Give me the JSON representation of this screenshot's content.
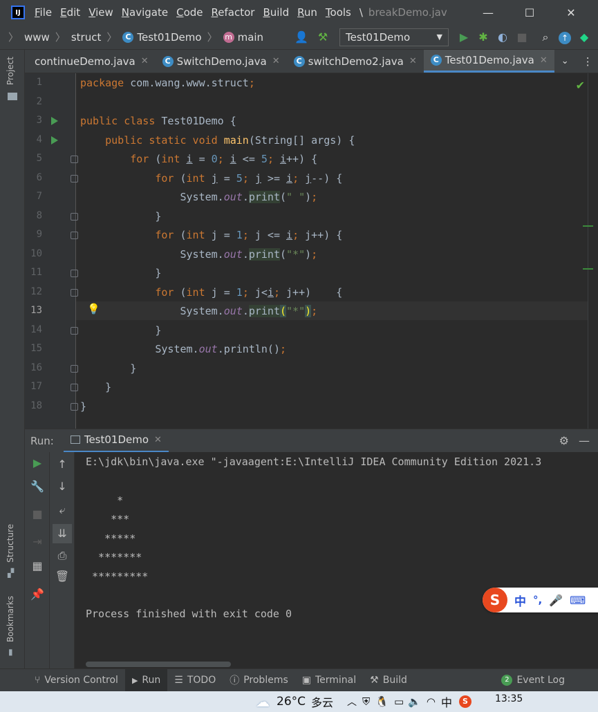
{
  "menu": {
    "logo": "IJ",
    "items": [
      {
        "first": "F",
        "rest": "ile"
      },
      {
        "first": "E",
        "rest": "dit"
      },
      {
        "first": "V",
        "rest": "iew"
      },
      {
        "first": "N",
        "rest": "avigate"
      },
      {
        "first": "C",
        "rest": "ode"
      },
      {
        "first": "R",
        "rest": "efactor"
      },
      {
        "first": "B",
        "rest": "uild"
      },
      {
        "first": "R",
        "rest": "un"
      },
      {
        "first": "T",
        "rest": "ools"
      }
    ],
    "overflow": "\\",
    "window_title": "breakDemo.jav",
    "minimize": "—",
    "maximize": "☐",
    "close": "✕"
  },
  "breadcrumb": {
    "items": [
      "www",
      "struct",
      "Test01Demo",
      "main"
    ],
    "class_badge": "C",
    "method_badge": "m"
  },
  "toolbar": {
    "run_config": "Test01Demo",
    "dropdown": "▼"
  },
  "tabs": [
    {
      "label": "continueDemo.java",
      "icon": "java-file-icon",
      "active": false
    },
    {
      "label": "SwitchDemo.java",
      "icon": "class-icon",
      "active": false
    },
    {
      "label": "switchDemo2.java",
      "icon": "class-icon",
      "active": false
    },
    {
      "label": "Test01Demo.java",
      "icon": "class-icon",
      "active": true
    }
  ],
  "side_panels": {
    "project": "Project",
    "structure": "Structure",
    "bookmarks": "Bookmarks"
  },
  "editor": {
    "line_numbers": [
      "1",
      "2",
      "3",
      "4",
      "5",
      "6",
      "7",
      "8",
      "9",
      "10",
      "11",
      "12",
      "13",
      "14",
      "15",
      "16",
      "17",
      "18"
    ],
    "current_line": "13"
  },
  "run_panel": {
    "label": "Run:",
    "tab": "Test01Demo",
    "console": [
      "E:\\jdk\\bin\\java.exe \"-javaagent:E:\\IntelliJ IDEA Community Edition 2021.3",
      "",
      "     *",
      "    ***",
      "   *****",
      "  *******",
      " *********",
      "",
      "Process finished with exit code 0"
    ]
  },
  "bottom_tools": [
    {
      "label": "Version Control",
      "icon": "branch-icon"
    },
    {
      "label": "Run",
      "icon": "play-icon",
      "active": true
    },
    {
      "label": "TODO",
      "icon": "list-icon"
    },
    {
      "label": "Problems",
      "icon": "info-icon"
    },
    {
      "label": "Terminal",
      "icon": "terminal-icon"
    },
    {
      "label": "Build",
      "icon": "hammer-icon"
    }
  ],
  "event_log": {
    "label": "Event Log",
    "count": "2"
  },
  "taskbar": {
    "weather_temp": "26°C",
    "weather_desc": "多云",
    "ime_lang": "中",
    "time": "13:35"
  },
  "ime_float": {
    "logo": "S",
    "lang": "中",
    "punct": "°,"
  },
  "colors": {
    "keyword": "#cc7832",
    "number": "#6897bb",
    "string": "#6a8759",
    "field": "#9876aa",
    "method": "#ffc66d",
    "accent": "#4a88c7",
    "run_green": "#499c54"
  }
}
